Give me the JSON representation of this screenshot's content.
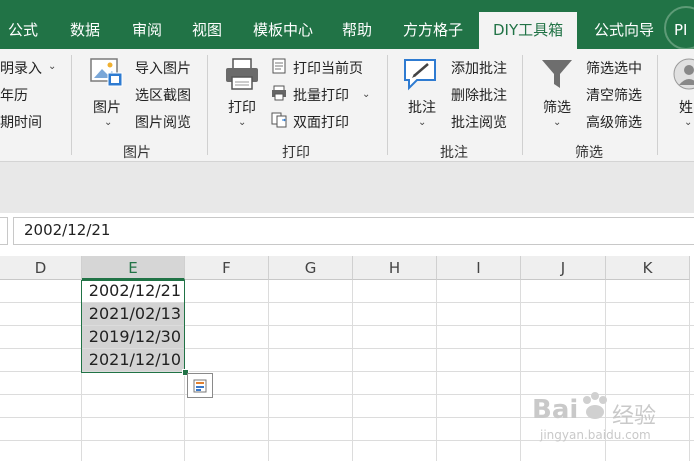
{
  "tabs": [
    "公式",
    "数据",
    "审阅",
    "视图",
    "模板中心",
    "帮助",
    "方方格子",
    "DIY工具箱",
    "公式向导",
    "PI"
  ],
  "active_tab": "DIY工具箱",
  "ribbon": {
    "left_items": [
      "明录入",
      "年历",
      "期时间"
    ],
    "picture_group": {
      "big_label": "图片",
      "items": [
        "导入图片",
        "选区截图",
        "图片阅览"
      ],
      "group_label": "图片"
    },
    "print_group": {
      "big_label": "打印",
      "items": [
        "打印当前页",
        "批量打印",
        "双面打印"
      ],
      "group_label": "打印"
    },
    "comment_group": {
      "big_label": "批注",
      "items": [
        "添加批注",
        "删除批注",
        "批注阅览"
      ],
      "group_label": "批注"
    },
    "filter_group": {
      "big_label": "筛选",
      "items": [
        "筛选选中",
        "清空筛选",
        "高级筛选"
      ],
      "group_label": "筛选"
    },
    "right_partial": "姓"
  },
  "formula_bar": {
    "value": "2002/12/21"
  },
  "columns": [
    "D",
    "E",
    "F",
    "G",
    "H",
    "I",
    "J",
    "K"
  ],
  "selected_column": "E",
  "cells": [
    "2002/12/21",
    "2021/02/13",
    "2019/12/30",
    "2021/12/10"
  ],
  "watermark": {
    "brand": "Bai",
    "brand2": "经验",
    "url": "jingyan.baidu.com"
  },
  "colors": {
    "accent": "#217346",
    "selection_fill": "#d3d3d3"
  }
}
